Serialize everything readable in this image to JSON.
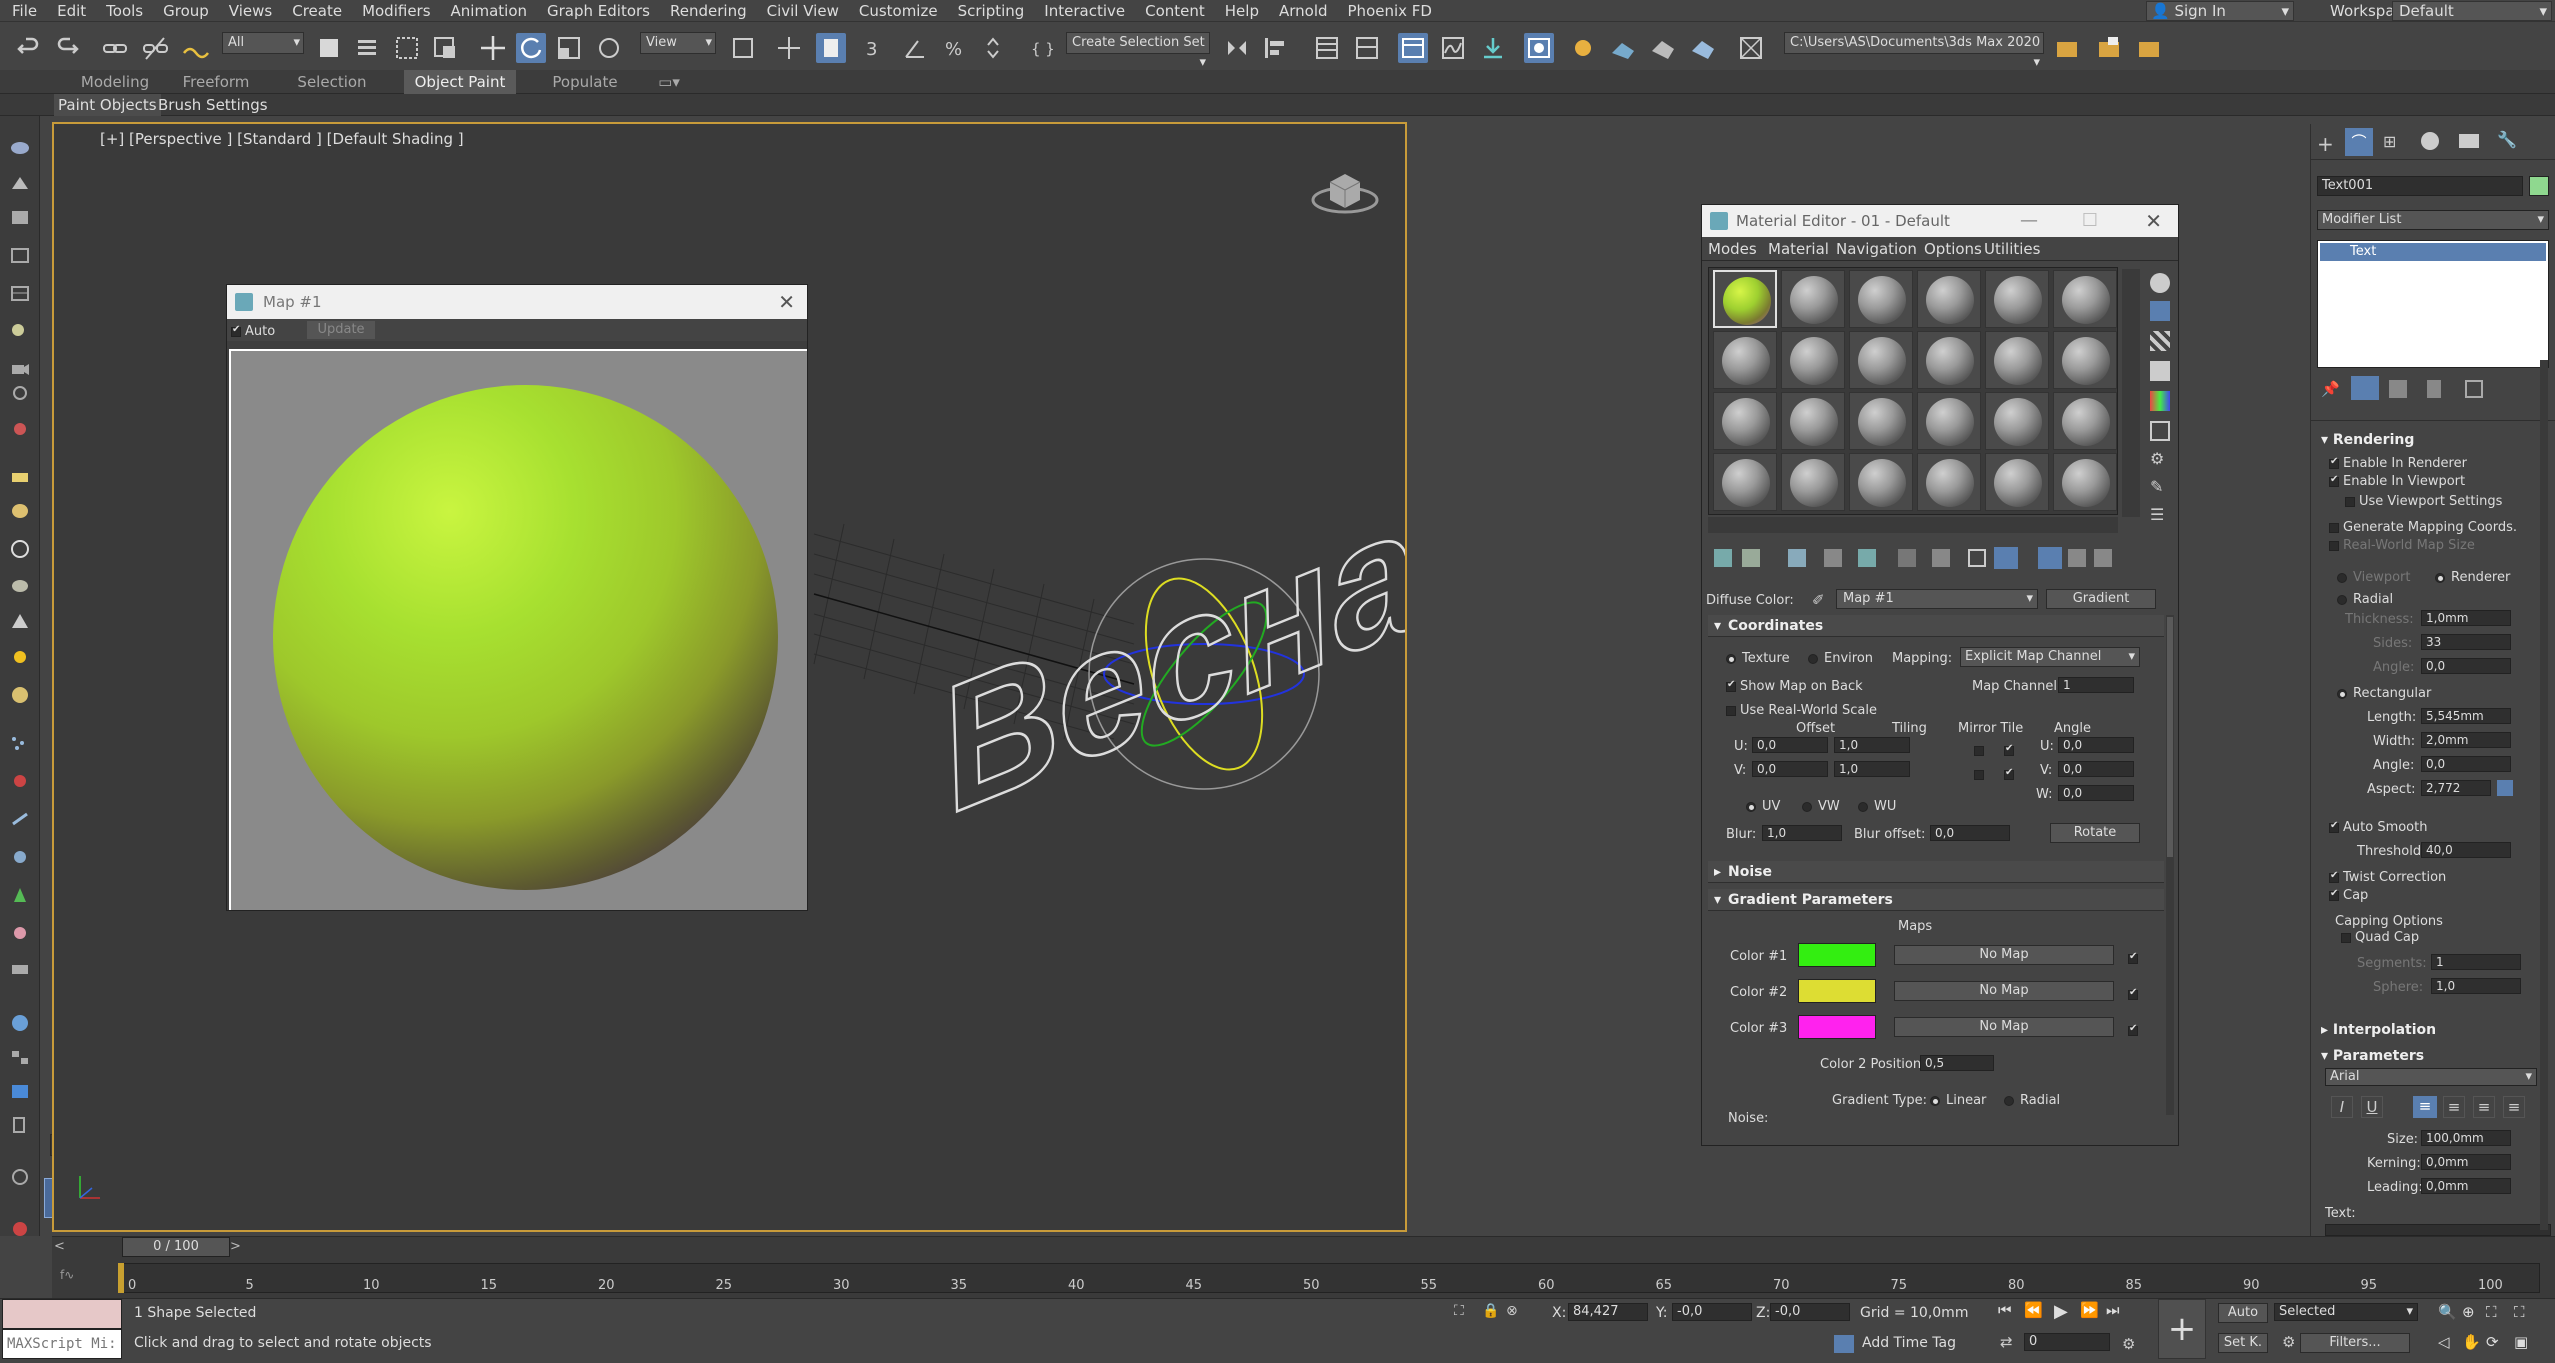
{
  "menubar": {
    "items": [
      "File",
      "Edit",
      "Tools",
      "Group",
      "Views",
      "Create",
      "Modifiers",
      "Animation",
      "Graph Editors",
      "Rendering",
      "Civil View",
      "Customize",
      "Scripting",
      "Interactive",
      "Content",
      "Help",
      "Arnold",
      "Phoenix FD"
    ],
    "sign_in": "Sign In",
    "workspaces_label": "Workspaces:",
    "workspace_value": "Default"
  },
  "toolbar": {
    "filter_value": "All",
    "view_value": "View",
    "selection_set": "Create Selection Set",
    "path": "C:\\Users\\AS\\Documents\\3ds Max 2020"
  },
  "ribbon": {
    "tabs": [
      "Modeling",
      "Freeform",
      "Selection",
      "Object Paint",
      "Populate"
    ],
    "active_tab": "Object Paint",
    "sub": [
      "Paint Objects",
      "Brush Settings"
    ]
  },
  "viewport": {
    "label": "[+] [Perspective ] [Standard ] [Default Shading ]",
    "text_object": "Весна"
  },
  "map_window": {
    "title": "Map #1",
    "auto_label": "Auto",
    "update_label": "Update"
  },
  "material_editor": {
    "title": "Material Editor - 01 - Default",
    "menu": [
      "Modes",
      "Material",
      "Navigation",
      "Options",
      "Utilities"
    ],
    "diffuse_label": "Diffuse Color:",
    "map_name": "Map #1",
    "map_type": "Gradient",
    "coordinates": {
      "title": "Coordinates",
      "texture": "Texture",
      "environ": "Environ",
      "mapping_label": "Mapping:",
      "mapping_value": "Explicit Map Channel",
      "show_map_on_back": "Show Map on Back",
      "map_channel_label": "Map Channel:",
      "map_channel_value": "1",
      "use_real_world": "Use Real-World Scale",
      "offset_hdr": "Offset",
      "tiling_hdr": "Tiling",
      "mirror_tile_hdr": "Mirror Tile",
      "angle_hdr": "Angle",
      "u_label": "U:",
      "v_label": "V:",
      "w_label": "W:",
      "u_offset": "0,0",
      "v_offset": "0,0",
      "u_tiling": "1,0",
      "v_tiling": "1,0",
      "u_angle": "0,0",
      "v_angle": "0,0",
      "w_angle": "0,0",
      "uv": "UV",
      "vw": "VW",
      "wu": "WU",
      "blur_label": "Blur:",
      "blur_value": "1,0",
      "blur_offset_label": "Blur offset:",
      "blur_offset_value": "0,0",
      "rotate_label": "Rotate"
    },
    "noise_rollout": "Noise",
    "gradient": {
      "title": "Gradient Parameters",
      "maps_hdr": "Maps",
      "colors": [
        {
          "label": "Color #1",
          "hex": "#33ee11",
          "map": "No Map"
        },
        {
          "label": "Color #2",
          "hex": "#dddd33",
          "map": "No Map"
        },
        {
          "label": "Color #3",
          "hex": "#ff22ee",
          "map": "No Map"
        }
      ],
      "pos_label": "Color 2 Position:",
      "pos_value": "0,5",
      "type_label": "Gradient Type:",
      "linear": "Linear",
      "radial": "Radial",
      "noise_label": "Noise:"
    }
  },
  "command_panel": {
    "object_name": "Text001",
    "object_color": "#8fd88f",
    "modifier_list": "Modifier List",
    "stack_item": "Text",
    "rendering": {
      "title": "Rendering",
      "enable_renderer": "Enable In Renderer",
      "enable_viewport": "Enable In Viewport",
      "use_viewport_settings": "Use Viewport Settings",
      "gen_mapping": "Generate Mapping Coords.",
      "real_world": "Real-World Map Size",
      "viewport": "Viewport",
      "renderer": "Renderer",
      "radial": "Radial",
      "thickness_label": "Thickness:",
      "thickness": "1,0mm",
      "sides_label": "Sides:",
      "sides": "33",
      "angle_label": "Angle:",
      "angle": "0,0",
      "rectangular": "Rectangular",
      "length_label": "Length:",
      "length": "5,545mm",
      "width_label": "Width:",
      "width": "2,0mm",
      "angle2_label": "Angle:",
      "angle2": "0,0",
      "aspect_label": "Aspect:",
      "aspect": "2,772",
      "auto_smooth": "Auto Smooth",
      "threshold_label": "Threshold:",
      "threshold": "40,0",
      "twist": "Twist Correction",
      "cap": "Cap",
      "capping_options": "Capping Options",
      "quad_cap": "Quad Cap",
      "segments_label": "Segments:",
      "segments": "1",
      "sphere_label": "Sphere:",
      "sphere": "1,0"
    },
    "interpolation": "Interpolation",
    "parameters": {
      "title": "Parameters",
      "font": "Arial",
      "size_label": "Size:",
      "size": "100,0mm",
      "kerning_label": "Kerning:",
      "kerning": "0,0mm",
      "leading_label": "Leading:",
      "leading": "0,0mm",
      "text_label": "Text:"
    }
  },
  "timeline": {
    "frame": "0 / 100",
    "ticks": [
      "0",
      "5",
      "10",
      "15",
      "20",
      "25",
      "30",
      "35",
      "40",
      "45",
      "50",
      "55",
      "60",
      "65",
      "70",
      "75",
      "80",
      "85",
      "90",
      "95",
      "100"
    ]
  },
  "statusbar": {
    "maxscript": "MAXScript Mi:",
    "status": "1 Shape Selected",
    "hint": "Click and drag to select and rotate objects",
    "x_label": "X:",
    "x": "84,427",
    "y_label": "Y:",
    "y": "-0,0",
    "z_label": "Z:",
    "z": "-0,0",
    "grid": "Grid = 10,0mm",
    "add_time_tag": "Add Time Tag",
    "auto": "Auto",
    "selected": "Selected",
    "set_k": "Set K.",
    "filters": "Filters...",
    "frame_field": "0"
  }
}
